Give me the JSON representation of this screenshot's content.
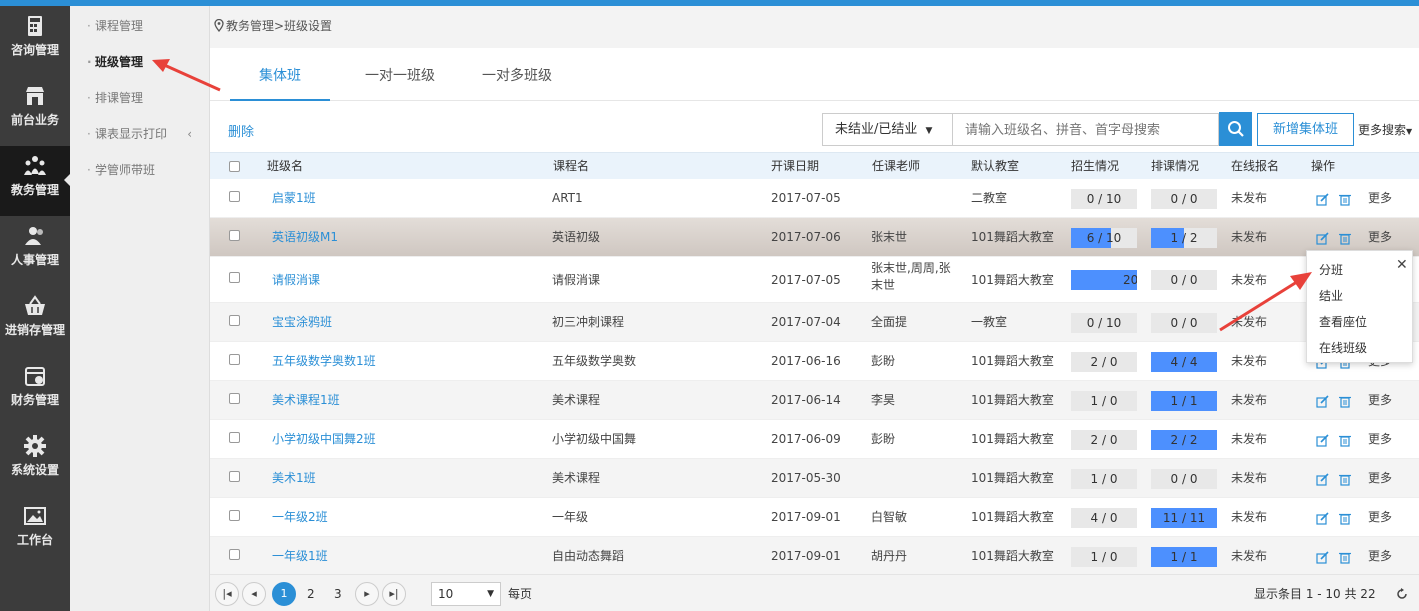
{
  "nav": {
    "items": [
      {
        "label": "咨询管理",
        "icon": "calculator-icon"
      },
      {
        "label": "前台业务",
        "icon": "store-icon"
      },
      {
        "label": "教务管理",
        "icon": "people-group-icon"
      },
      {
        "label": "人事管理",
        "icon": "users-icon"
      },
      {
        "label": "进销存管理",
        "icon": "basket-icon"
      },
      {
        "label": "财务管理",
        "icon": "calendar-icon"
      },
      {
        "label": "系统设置",
        "icon": "gear-icon"
      },
      {
        "label": "工作台",
        "icon": "image-icon"
      }
    ],
    "active_index": 2
  },
  "submenu": {
    "items": [
      {
        "label": "课程管理"
      },
      {
        "label": "班级管理"
      },
      {
        "label": "排课管理"
      },
      {
        "label": "课表显示打印",
        "chevron": "‹"
      },
      {
        "label": "学管师带班"
      }
    ],
    "active_index": 1
  },
  "breadcrumb": {
    "text": "教务管理>班级设置"
  },
  "tabs": [
    {
      "label": "集体班"
    },
    {
      "label": "一对一班级"
    },
    {
      "label": "一对多班级"
    }
  ],
  "toolbar": {
    "delete_label": "删除",
    "status_value": "未结业/已结业",
    "search_placeholder": "请输入班级名、拼音、首字母搜索",
    "add_label": "新增集体班",
    "more_search_label": "更多搜索"
  },
  "table": {
    "headers": [
      "班级名",
      "课程名",
      "开课日期",
      "任课老师",
      "默认教室",
      "招生情况",
      "排课情况",
      "在线报名",
      "操作"
    ],
    "more_label": "更多",
    "rows": [
      {
        "name": "启蒙1班",
        "course": "ART1",
        "date": "2017-07-05",
        "teacher": "",
        "room": "二教室",
        "enroll": "0 / 10",
        "enroll_fill": 0,
        "sched": "0 / 0",
        "sched_fill": 0,
        "online": "未发布"
      },
      {
        "name": "英语初级M1",
        "course": "英语初级",
        "date": "2017-07-06",
        "teacher": "张末世",
        "room": "101舞蹈大教室",
        "enroll": "6 / 10",
        "enroll_fill": 0.6,
        "sched": "1 / 2",
        "sched_fill": 0.5,
        "online": "未发布"
      },
      {
        "name": "请假消课",
        "course": "请假消课",
        "date": "2017-07-05",
        "teacher": "张末世,周周,张末世",
        "room": "101舞蹈大教室",
        "enroll": "20",
        "enroll_fill": 1,
        "sched": "0 / 0",
        "sched_fill": 0,
        "online": "未发布"
      },
      {
        "name": "宝宝涂鸦班",
        "course": "初三冲刺课程",
        "date": "2017-07-04",
        "teacher": "全面提",
        "room": "一教室",
        "enroll": "0 / 10",
        "enroll_fill": 0,
        "sched": "0 / 0",
        "sched_fill": 0,
        "online": "未发布"
      },
      {
        "name": "五年级数学奥数1班",
        "course": "五年级数学奥数",
        "date": "2017-06-16",
        "teacher": "彭盼",
        "room": "101舞蹈大教室",
        "enroll": "2 / 0",
        "enroll_fill": 0,
        "sched": "4 / 4",
        "sched_fill": 1,
        "online": "未发布"
      },
      {
        "name": "美术课程1班",
        "course": "美术课程",
        "date": "2017-06-14",
        "teacher": "李昊",
        "room": "101舞蹈大教室",
        "enroll": "1 / 0",
        "enroll_fill": 0,
        "sched": "1 / 1",
        "sched_fill": 1,
        "online": "未发布"
      },
      {
        "name": "小学初级中国舞2班",
        "course": "小学初级中国舞",
        "date": "2017-06-09",
        "teacher": "彭盼",
        "room": "101舞蹈大教室",
        "enroll": "2 / 0",
        "enroll_fill": 0,
        "sched": "2 / 2",
        "sched_fill": 1,
        "online": "未发布"
      },
      {
        "name": "美术1班",
        "course": "美术课程",
        "date": "2017-05-30",
        "teacher": "",
        "room": "101舞蹈大教室",
        "enroll": "1 / 0",
        "enroll_fill": 0,
        "sched": "0 / 0",
        "sched_fill": 0,
        "online": "未发布"
      },
      {
        "name": "一年级2班",
        "course": "一年级",
        "date": "2017-09-01",
        "teacher": "白智敏",
        "room": "101舞蹈大教室",
        "enroll": "4 / 0",
        "enroll_fill": 0,
        "sched": "11 / 11",
        "sched_fill": 1,
        "online": "未发布"
      },
      {
        "name": "一年级1班",
        "course": "自由动态舞蹈",
        "date": "2017-09-01",
        "teacher": "胡丹丹",
        "room": "101舞蹈大教室",
        "enroll": "1 / 0",
        "enroll_fill": 0,
        "sched": "1 / 1",
        "sched_fill": 1,
        "online": "未发布"
      }
    ]
  },
  "popup": {
    "items": [
      "分班",
      "结业",
      "查看座位",
      "在线班级"
    ],
    "close": "✕"
  },
  "pagination": {
    "pages": [
      "1",
      "2",
      "3"
    ],
    "current": "1",
    "page_size": "10",
    "per_page_label": "每页",
    "summary": "显示条目 1 - 10 共 22"
  },
  "colors": {
    "accent": "#2b8fd6",
    "bar_fill": "#4d90fe",
    "annotation_arrow": "#e8413a"
  }
}
